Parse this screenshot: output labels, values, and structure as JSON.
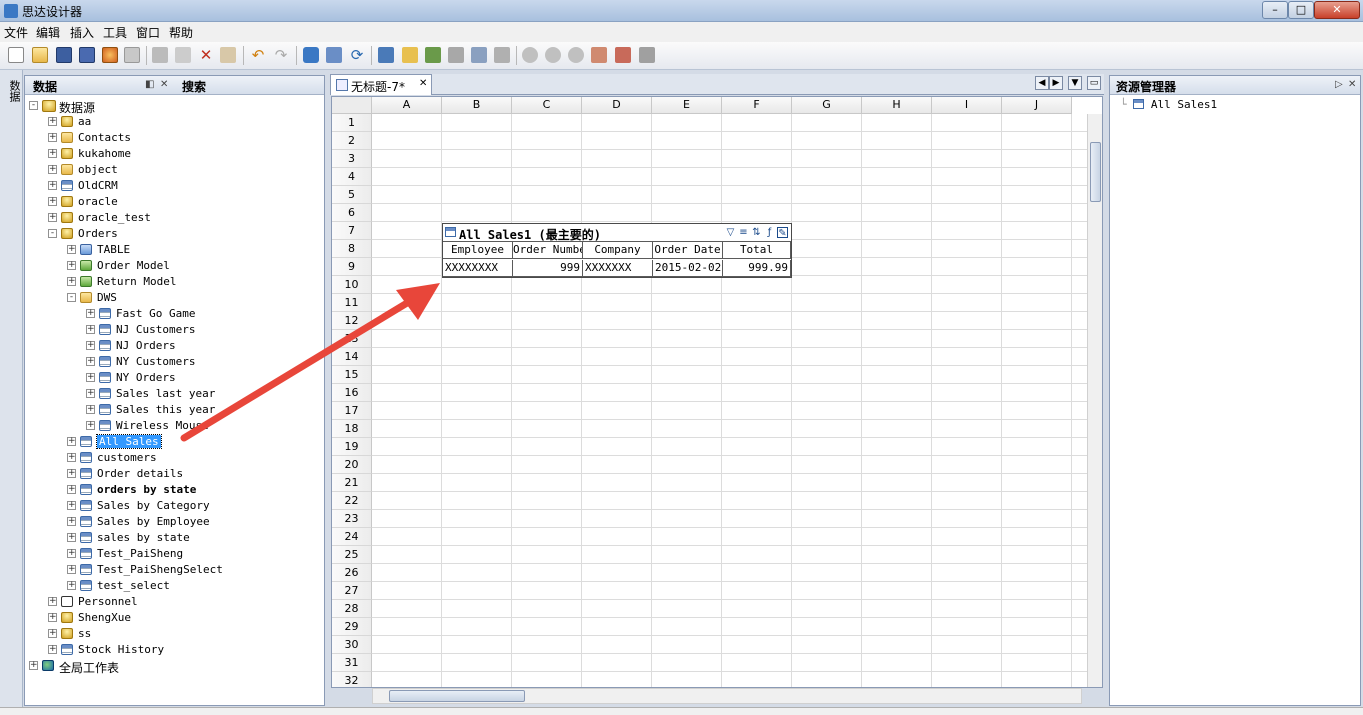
{
  "window": {
    "title": "思达设计器"
  },
  "menu": [
    "文件",
    "编辑",
    "插入",
    "工具",
    "窗口",
    "帮助"
  ],
  "left_strip": {
    "label": "数据"
  },
  "data_panel": {
    "tab_data": "数据",
    "tab_search": "搜索"
  },
  "tree": [
    {
      "label": "数据源",
      "depth": 0,
      "icon": "database",
      "exp": "-"
    },
    {
      "label": "aa",
      "depth": 1,
      "icon": "database",
      "exp": "+"
    },
    {
      "label": "Contacts",
      "depth": 1,
      "icon": "contacts",
      "exp": "+"
    },
    {
      "label": "kukahome",
      "depth": 1,
      "icon": "database",
      "exp": "+"
    },
    {
      "label": "object",
      "depth": 1,
      "icon": "object",
      "exp": "+"
    },
    {
      "label": "OldCRM",
      "depth": 1,
      "icon": "document",
      "exp": "+"
    },
    {
      "label": "oracle",
      "depth": 1,
      "icon": "database",
      "exp": "+"
    },
    {
      "label": "oracle_test",
      "depth": 1,
      "icon": "database",
      "exp": "+"
    },
    {
      "label": "Orders",
      "depth": 1,
      "icon": "database",
      "exp": "-"
    },
    {
      "label": "TABLE",
      "depth": 2,
      "icon": "folder-blue",
      "exp": "+"
    },
    {
      "label": "Order Model",
      "depth": 2,
      "icon": "folder-green",
      "exp": "+"
    },
    {
      "label": "Return Model",
      "depth": 2,
      "icon": "folder-green",
      "exp": "+"
    },
    {
      "label": "DWS",
      "depth": 2,
      "icon": "folder",
      "exp": "-"
    },
    {
      "label": "Fast Go Game",
      "depth": 3,
      "icon": "table",
      "exp": "+"
    },
    {
      "label": "NJ Customers",
      "depth": 3,
      "icon": "table",
      "exp": "+"
    },
    {
      "label": "NJ Orders",
      "depth": 3,
      "icon": "table",
      "exp": "+"
    },
    {
      "label": "NY Customers",
      "depth": 3,
      "icon": "table",
      "exp": "+"
    },
    {
      "label": "NY Orders",
      "depth": 3,
      "icon": "table",
      "exp": "+"
    },
    {
      "label": "Sales last year",
      "depth": 3,
      "icon": "table",
      "exp": "+"
    },
    {
      "label": "Sales this year",
      "depth": 3,
      "icon": "table",
      "exp": "+"
    },
    {
      "label": "Wireless Mouse",
      "depth": 3,
      "icon": "table",
      "exp": "+"
    },
    {
      "label": "All Sales",
      "depth": 2,
      "icon": "table",
      "exp": "+",
      "selected": true
    },
    {
      "label": "customers",
      "depth": 2,
      "icon": "table",
      "exp": "+"
    },
    {
      "label": "Order details",
      "depth": 2,
      "icon": "table",
      "exp": "+"
    },
    {
      "label": "orders by state",
      "depth": 2,
      "icon": "table",
      "exp": "+",
      "bold": true
    },
    {
      "label": "Sales by Category",
      "depth": 2,
      "icon": "table",
      "exp": "+"
    },
    {
      "label": "Sales by Employee",
      "depth": 2,
      "icon": "table",
      "exp": "+"
    },
    {
      "label": "sales by state",
      "depth": 2,
      "icon": "table",
      "exp": "+"
    },
    {
      "label": "Test_PaiSheng",
      "depth": 2,
      "icon": "table",
      "exp": "+"
    },
    {
      "label": "Test_PaiShengSelect",
      "depth": 2,
      "icon": "table",
      "exp": "+"
    },
    {
      "label": "test_select",
      "depth": 2,
      "icon": "table",
      "exp": "+"
    },
    {
      "label": "Personnel",
      "depth": 1,
      "icon": "excel",
      "exp": "+"
    },
    {
      "label": "ShengXue",
      "depth": 1,
      "icon": "database",
      "exp": "+"
    },
    {
      "label": "ss",
      "depth": 1,
      "icon": "database",
      "exp": "+"
    },
    {
      "label": "Stock History",
      "depth": 1,
      "icon": "document",
      "exp": "+"
    },
    {
      "label": "全局工作表",
      "depth": 0,
      "icon": "globe",
      "exp": "+"
    }
  ],
  "doc_tab": {
    "label": "无标题-7*",
    "close": "✕"
  },
  "sheet": {
    "columns": [
      "A",
      "B",
      "C",
      "D",
      "E",
      "F",
      "G",
      "H",
      "I",
      "J"
    ],
    "rows": [
      "1",
      "2",
      "3",
      "4",
      "5",
      "6",
      "7",
      "8",
      "9",
      "10",
      "11",
      "12",
      "13",
      "14",
      "15",
      "16",
      "17",
      "18",
      "19",
      "20",
      "21",
      "22",
      "23",
      "24",
      "25",
      "26",
      "27",
      "28",
      "29",
      "30",
      "31",
      "32"
    ]
  },
  "report": {
    "title": "All Sales1 (最主要的)",
    "headers": [
      "Employee",
      "Order Number",
      "Company",
      "Order Date",
      "Total"
    ],
    "row": [
      "XXXXXXXX",
      "999",
      "XXXXXXX",
      "2015-02-02",
      "999.99"
    ]
  },
  "resource_panel": {
    "title": "资源管理器",
    "item": "All Sales1"
  }
}
